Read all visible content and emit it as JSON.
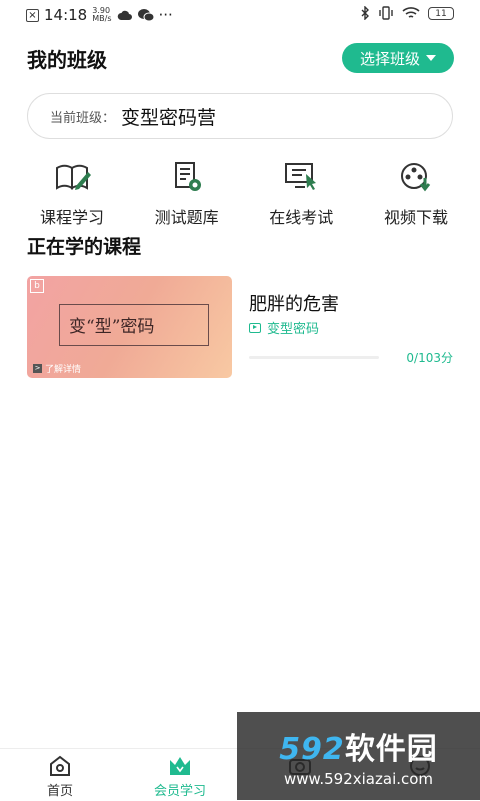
{
  "status_bar": {
    "time": "14:18",
    "speed_value": "3.90",
    "speed_unit": "MB/s",
    "more": "···",
    "battery": "11"
  },
  "header": {
    "title": "我的班级",
    "select_class_label": "选择班级"
  },
  "current_class": {
    "label": "当前班级：",
    "value": "变型密码营"
  },
  "features": [
    {
      "label": "课程学习",
      "icon": "book-pen-icon"
    },
    {
      "label": "测试题库",
      "icon": "document-search-icon"
    },
    {
      "label": "在线考试",
      "icon": "monitor-cursor-icon"
    },
    {
      "label": "视频下载",
      "icon": "film-download-icon"
    }
  ],
  "section": {
    "title": "正在学的课程"
  },
  "course": {
    "thumbnail_text": "变“型”密码",
    "thumbnail_more": "了解详情",
    "title": "肥胖的危害",
    "subtitle": "变型密码",
    "progress_fraction": 0,
    "score": "0/103分"
  },
  "tabs": [
    {
      "label": "首页",
      "icon": "home-icon",
      "active": false
    },
    {
      "label": "会员学习",
      "icon": "crown-icon",
      "active": true
    },
    {
      "label": "",
      "icon": "camera-icon",
      "active": false
    },
    {
      "label": "",
      "icon": "smile-icon",
      "active": false
    }
  ],
  "watermark": {
    "brand_number": "592",
    "brand_text": "软件园",
    "url": "www.592xiazai.com"
  },
  "colors": {
    "accent": "#1fba8f"
  }
}
